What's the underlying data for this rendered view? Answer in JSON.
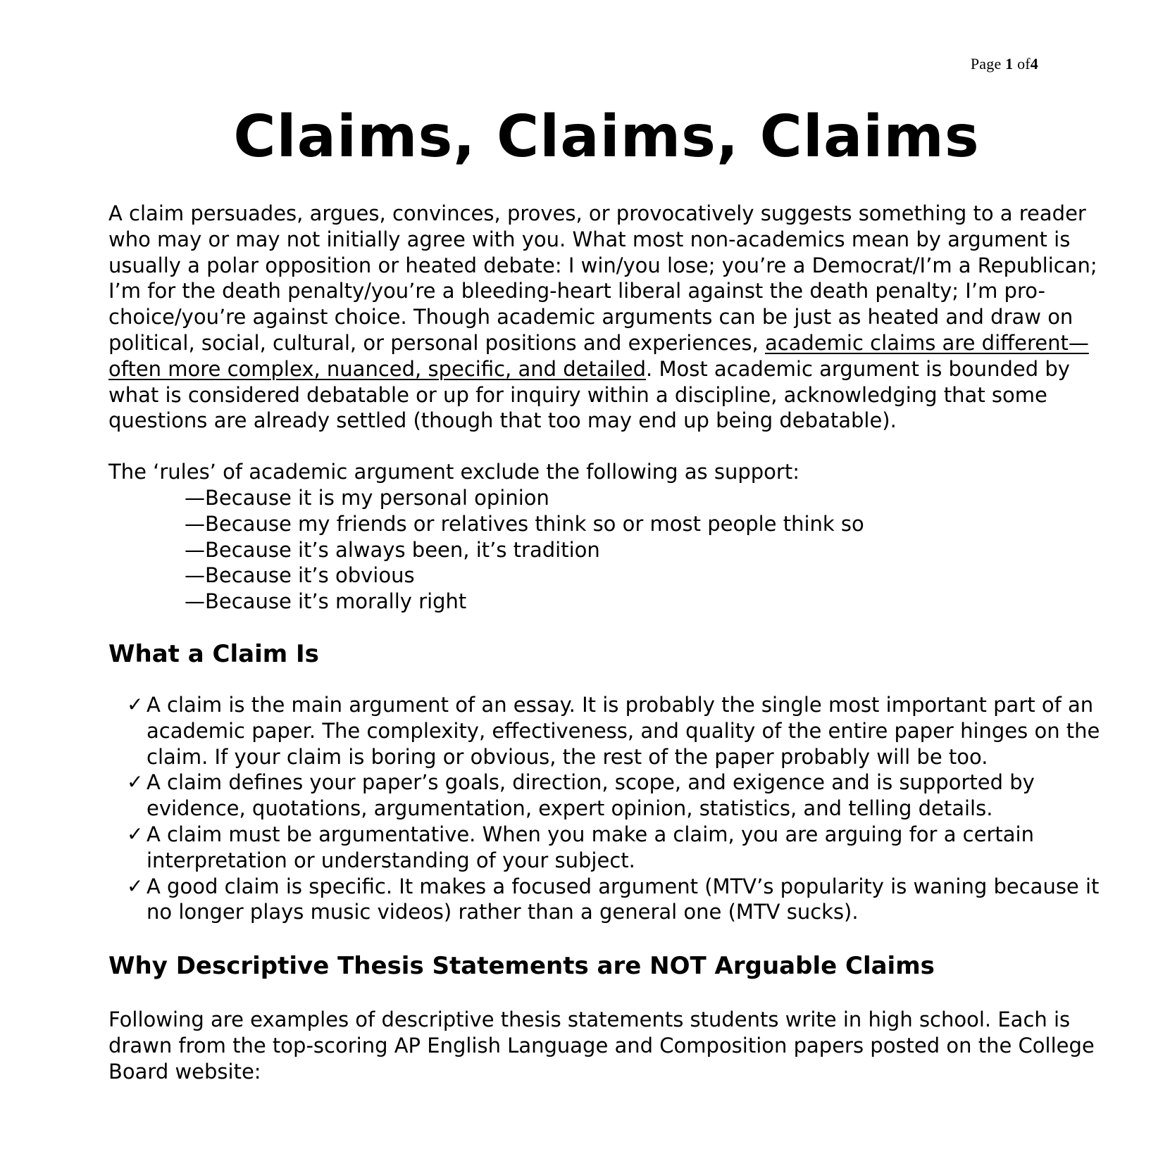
{
  "header": {
    "page_label": "Page",
    "page_current": "1",
    "page_of": "of",
    "page_total": "4"
  },
  "title": "Claims, Claims, Claims",
  "intro": {
    "text_before": "A claim persuades, argues, convinces, proves, or provocatively suggests something to a reader who may or may not initially agree with you. What most non-academics mean by argument is usually a polar opposition or heated debate: I win/you lose; you’re a Democrat/I’m a Republican; I’m for the death penalty/you’re a bleeding-heart liberal against the death penalty; I’m pro-choice/you’re against choice. Though academic arguments can be just as heated and draw on political, social, cultural, or personal positions and experiences, ",
    "underlined": "academic claims are different—often more complex, nuanced, specific, and detailed",
    "text_after": ". Most academic argument is bounded by what is considered debatable or up for inquiry within a discipline, acknowledging that some questions are already settled (though that too may end up being debatable)."
  },
  "rules": {
    "lead": "The ‘rules’ of academic argument exclude the following as support:",
    "items": [
      "—Because it is my personal opinion",
      "—Because my friends or relatives think so or most people think so",
      "—Because it’s always been, it’s tradition",
      "—Because it’s obvious",
      "—Because it’s morally right"
    ]
  },
  "what_a_claim_is": {
    "heading": "What a Claim Is",
    "check_symbol": "✓",
    "items": [
      "A claim is the main argument of an essay. It is probably the single most important part of an academic paper. The complexity, effectiveness, and quality of the entire paper hinges on the claim. If your claim is boring or obvious, the rest of the paper probably will be too.",
      "A claim defines your paper’s goals, direction, scope, and exigence and is supported by evidence, quotations, argumentation, expert opinion, statistics, and telling details.",
      "A claim must be argumentative. When you make a claim, you are arguing for a certain interpretation or understanding of your subject.",
      "A good claim is specific. It makes a focused argument (MTV’s popularity is waning because it no longer plays music videos) rather than a general one (MTV sucks)."
    ]
  },
  "why_descriptive": {
    "heading": "Why Descriptive Thesis Statements are NOT Arguable Claims",
    "paragraph": "Following are examples of descriptive thesis statements students write in high school. Each is drawn from the top-scoring AP English Language and Composition papers posted on the College Board website:"
  }
}
